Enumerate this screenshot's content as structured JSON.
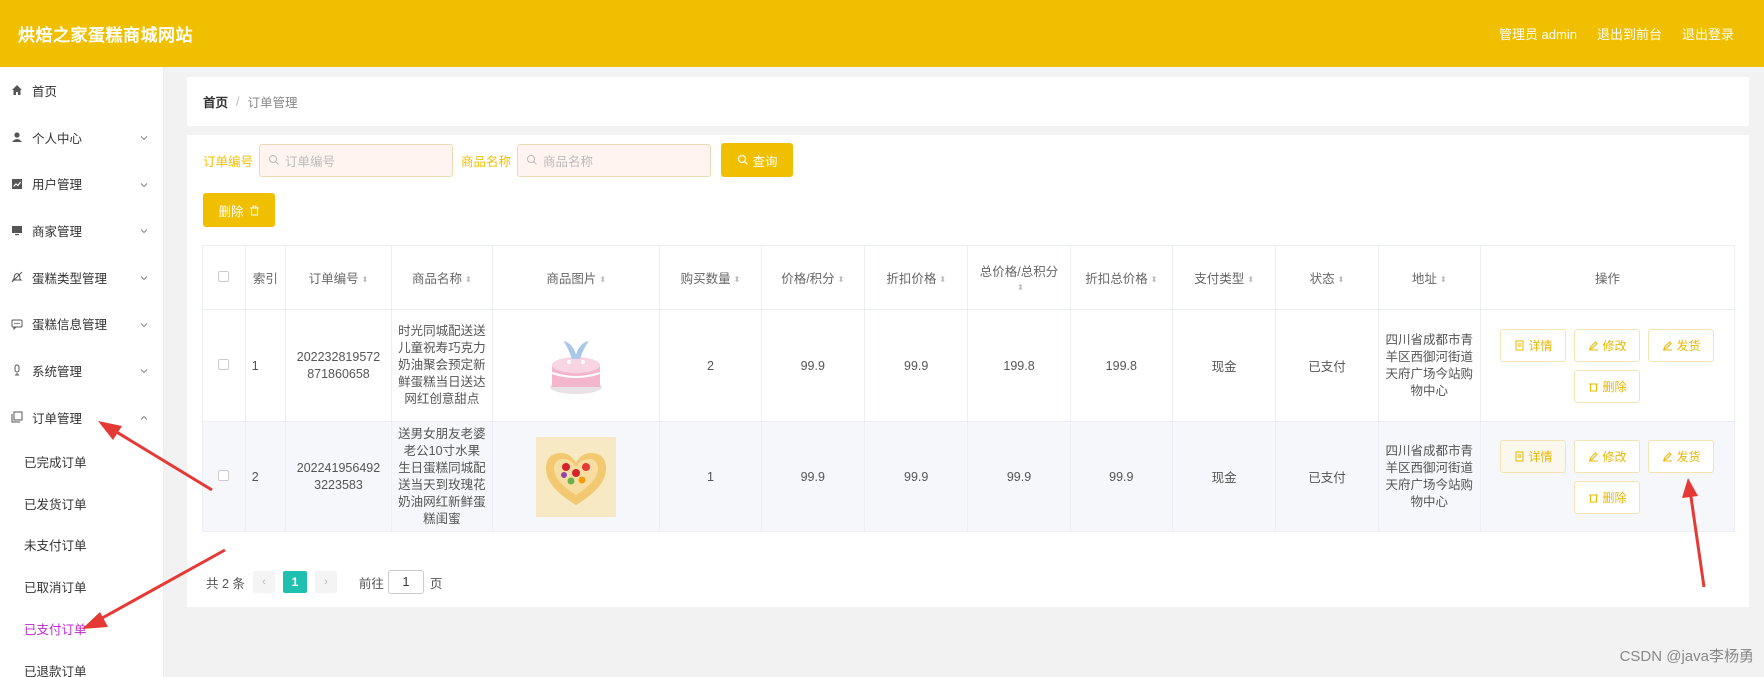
{
  "header": {
    "title": "烘焙之家蛋糕商城网站",
    "admin": "管理员 admin",
    "to_front": "退出到前台",
    "logout": "退出登录"
  },
  "sidebar": {
    "items": [
      {
        "label": "首页",
        "icon": "home-icon"
      },
      {
        "label": "个人中心",
        "icon": "user-icon"
      },
      {
        "label": "用户管理",
        "icon": "chart-icon"
      },
      {
        "label": "商家管理",
        "icon": "monitor-icon"
      },
      {
        "label": "蛋糕类型管理",
        "icon": "bell-icon"
      },
      {
        "label": "蛋糕信息管理",
        "icon": "message-icon"
      },
      {
        "label": "系统管理",
        "icon": "microphone-icon"
      },
      {
        "label": "订单管理",
        "icon": "copy-icon"
      }
    ],
    "sub_items": [
      "已完成订单",
      "已发货订单",
      "未支付订单",
      "已取消订单",
      "已支付订单",
      "已退款订单"
    ],
    "active_sub": "已支付订单"
  },
  "breadcrumb": {
    "home": "首页",
    "sep": "/",
    "current": "订单管理"
  },
  "search": {
    "order_label": "订单编号",
    "order_placeholder": "订单编号",
    "goods_label": "商品名称",
    "goods_placeholder": "商品名称",
    "query": "查询"
  },
  "delete_btn": "删除",
  "table": {
    "headers": {
      "index": "索引",
      "order_no": "订单编号",
      "goods_name": "商品名称",
      "goods_img": "商品图片",
      "qty": "购买数量",
      "price": "价格/积分",
      "disc_price": "折扣价格",
      "total": "总价格/总积分",
      "disc_total": "折扣总价格",
      "pay_type": "支付类型",
      "status": "状态",
      "address": "地址",
      "ops": "操作"
    },
    "rows": [
      {
        "index": "1",
        "order_no": "202232819572871860658",
        "goods_name": "时光同城配送送儿童祝寿巧克力奶油聚会预定新鲜蛋糕当日送达网红创意甜点",
        "qty": "2",
        "price": "99.9",
        "disc_price": "99.9",
        "total": "199.8",
        "disc_total": "199.8",
        "pay_type": "现金",
        "status": "已支付",
        "address": "四川省成都市青羊区西御河街道天府广场今站购物中心"
      },
      {
        "index": "2",
        "order_no": "2022419564923223583",
        "goods_name": "送男女朋友老婆老公10寸水果生日蛋糕同城配送当天到玫瑰花奶油网红新鲜蛋糕闺蜜",
        "qty": "1",
        "price": "99.9",
        "disc_price": "99.9",
        "total": "99.9",
        "disc_total": "99.9",
        "pay_type": "现金",
        "status": "已支付",
        "address": "四川省成都市青羊区西御河街道天府广场今站购物中心"
      }
    ],
    "op_labels": {
      "detail": "详情",
      "edit": "修改",
      "ship": "发货",
      "delete": "删除"
    }
  },
  "pager": {
    "total": "共 2 条",
    "current": "1",
    "goto": "前往",
    "page_input": "1",
    "page_unit": "页"
  },
  "watermark": "CSDN @java李杨勇",
  "colors": {
    "primary": "#f0bf00",
    "active_sub": "#c026d3",
    "pager_active": "#20c0b0",
    "arrow": "#e53935"
  }
}
